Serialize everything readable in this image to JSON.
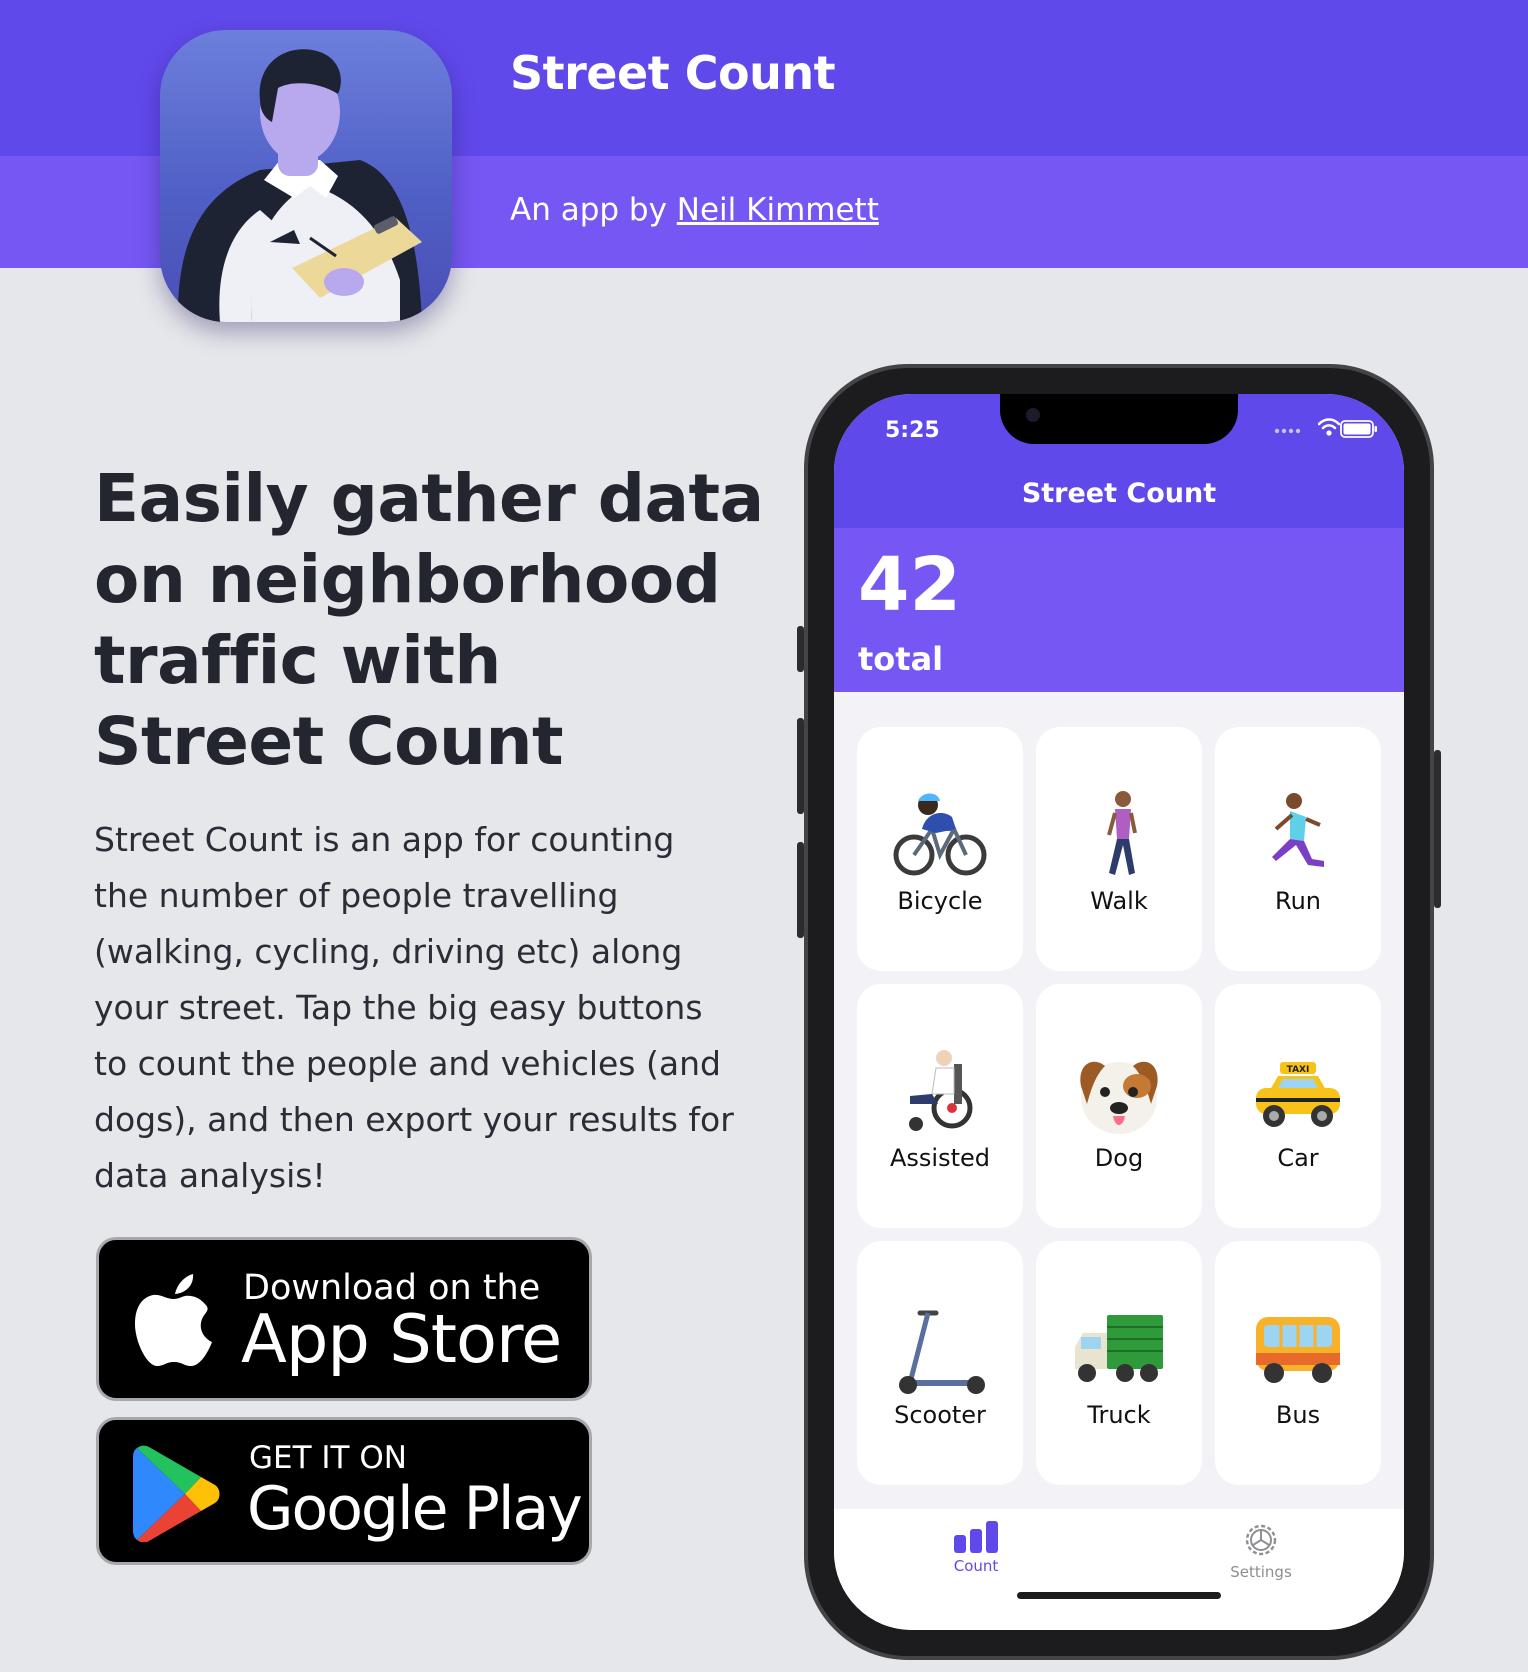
{
  "header": {
    "title": "Street Count",
    "by_prefix": "An app by ",
    "author_link": "Neil Kimmett",
    "app_icon": "app-icon-person-with-clipboard"
  },
  "hero": {
    "headline_lines": [
      "Easily gather data",
      "on neighborhood",
      "traffic with"
    ],
    "headline_bold": "Street Count",
    "description": "Street Count is an app for counting the number of people travelling (walking, cycling, driving etc) along your street. Tap the big easy buttons to count the people and vehicles (and dogs), and then export your results for data analysis!"
  },
  "badges": {
    "apple": {
      "small": "Download on the",
      "big": "App Store",
      "icon": "apple-logo"
    },
    "google": {
      "small": "GET IT ON",
      "big": "Google Play",
      "icon": "google-play-logo"
    }
  },
  "phone": {
    "status_time": "5:25",
    "nav_title": "Street Count",
    "count_value": "42",
    "count_label": "total",
    "tiles": [
      {
        "label": "Bicycle",
        "icon": "bicycle-emoji"
      },
      {
        "label": "Walk",
        "icon": "walk-emoji"
      },
      {
        "label": "Run",
        "icon": "run-emoji"
      },
      {
        "label": "Assisted",
        "icon": "wheelchair-emoji"
      },
      {
        "label": "Dog",
        "icon": "dog-emoji"
      },
      {
        "label": "Car",
        "icon": "taxi-emoji"
      },
      {
        "label": "Scooter",
        "icon": "scooter-emoji"
      },
      {
        "label": "Truck",
        "icon": "truck-emoji"
      },
      {
        "label": "Bus",
        "icon": "bus-emoji"
      }
    ],
    "taxi_sign": "TAXI",
    "tabs": [
      {
        "label": "Count",
        "icon": "bar-chart-icon",
        "selected": true
      },
      {
        "label": "Settings",
        "icon": "gear-icon",
        "selected": false
      }
    ]
  },
  "colors": {
    "header_top": "#6049ea",
    "header_bottom": "#7657f3",
    "page_background": "#e6e7eb",
    "accent": "#6049ea"
  }
}
